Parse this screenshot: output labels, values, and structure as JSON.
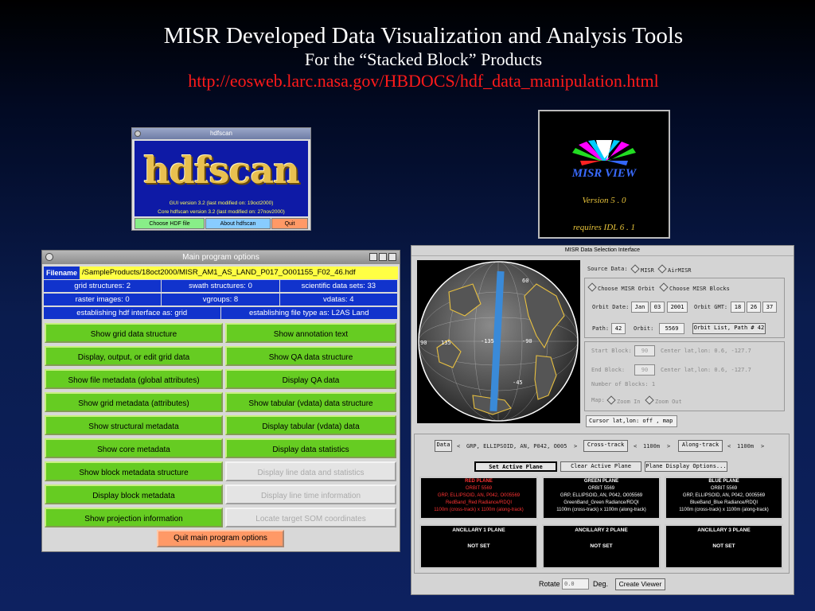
{
  "header": {
    "title": "MISR Developed Data Visualization and Analysis Tools",
    "subtitle": "For the “Stacked Block” Products",
    "url": "http://eosweb.larc.nasa.gov/HBDOCS/hdf_data_manipulation.html"
  },
  "hdfscan": {
    "window_title": "hdfscan",
    "logo": "hdfscan",
    "gui_version": "GUI version 3.2 (last modified on: 19oct2000)",
    "core_version": "Core hdfscan version 3.2 (last modified on: 27nov2000)",
    "buttons": [
      "Choose HDF file",
      "About hdfscan",
      "Quit"
    ]
  },
  "misrview": {
    "title": "MISR VIEW",
    "version": "Version 5 . 0",
    "requires": "requires IDL 6 . 1"
  },
  "main": {
    "window_title": "Main program options",
    "filename_label": "Filename",
    "filename": "/SampleProducts/18oct2000/MISR_AM1_AS_LAND_P017_O001155_F02_46.hdf",
    "stats_row1": [
      "grid structures: 2",
      "swath structures: 0",
      "scientific data sets: 33"
    ],
    "stats_row2": [
      "raster images: 0",
      "vgroups: 8",
      "vdatas: 4"
    ],
    "stats_row3": [
      "establishing hdf interface as: grid",
      "establishing file type as: L2AS Land"
    ],
    "left_buttons": [
      "Show grid data structure",
      "Display, output, or edit grid data",
      "Show file metadata (global attributes)",
      "Show grid metadata (attributes)",
      "Show structural metadata",
      "Show core metadata",
      "Show block metadata structure",
      "Display block metadata",
      "Show projection information"
    ],
    "right_buttons": [
      "Show annotation text",
      "Show QA data structure",
      "Display QA data",
      "Show tabular (vdata) data structure",
      "Display tabular (vdata) data",
      "Display data statistics",
      "Display line data and statistics",
      "Display line time information",
      "Locate target SOM coordinates"
    ],
    "quit": "Quit main program options"
  },
  "dsel": {
    "window_title": "MISR Data Selection Interface",
    "source_label": "Source Data:",
    "source_opts": [
      "MISR",
      "AirMISR"
    ],
    "choose_opts": [
      "Choose MISR Orbit",
      "Choose MISR Blocks"
    ],
    "orbit_date_label": "Orbit Date:",
    "orbit_date": [
      "Jan",
      "03",
      "2001"
    ],
    "orbit_gmt_label": "Orbit GMT:",
    "orbit_gmt": [
      "18",
      "26",
      "37"
    ],
    "path_label": "Path:",
    "path": "42",
    "orbit_label": "Orbit:",
    "orbit": "5569",
    "orbit_list_btn": "Orbit List, Path # 42",
    "start_block_label": "Start Block:",
    "start_block": "90",
    "end_block_label": "End Block:",
    "end_block": "90",
    "center1": "Center lat,lon:  0.6, -127.7",
    "center2": "Center lat,lon:  0.6, -127.7",
    "num_blocks": "Number of Blocks: 1",
    "map_label": "Map:",
    "map_opts": [
      "Zoom In",
      "Zoom Out"
    ],
    "cursor": "Cursor lat,lon:  off , map",
    "data_label": "Data",
    "data_value": "GRP, ELLIPSOID, AN, P042, O005",
    "cross_track": "Cross-track",
    "cross_res": "1100m",
    "along_track": "Along-track",
    "along_res": "1100m",
    "set_active": "Set Active Plane",
    "clear_active": "Clear Active Plane",
    "plane_display": "Plane Display Options...",
    "planes": [
      {
        "title": "RED PLANE",
        "orbit": "ORBIT 5569",
        "grp": "GRP, ELLIPSOID, AN, P042, O005569",
        "band": "RedBand_Red Radiance/RDQI",
        "res": "1100m (cross-track) x 1100m (along-track)"
      },
      {
        "title": "GREEN PLANE",
        "orbit": "ORBIT 5569",
        "grp": "GRP, ELLIPSOID, AN, P042, O005569",
        "band": "GreenBand_Green Radiance/RDQI",
        "res": "1100m (cross-track) x 1100m (along-track)"
      },
      {
        "title": "BLUE PLANE",
        "orbit": "ORBIT 5569",
        "grp": "GRP, ELLIPSOID, AN, P042, O005569",
        "band": "BlueBand_Blue Radiance/RDQI",
        "res": "1100m (cross-track) x 1100m (along-track)"
      }
    ],
    "anc": [
      {
        "title": "ANCILLARY 1 PLANE",
        "status": "NOT SET"
      },
      {
        "title": "ANCILLARY 2 PLANE",
        "status": "NOT SET"
      },
      {
        "title": "ANCILLARY 3 PLANE",
        "status": "NOT SET"
      }
    ],
    "globe_labels": [
      "60",
      "-135",
      "-90",
      "90",
      "135",
      "-45"
    ],
    "rotate_label": "Rotate",
    "rotate_value": "0.0",
    "deg_label": "Deg.",
    "create_viewer": "Create Viewer"
  },
  "colors": {
    "button_green": "#66cc22",
    "header_blue": "#1133cc",
    "filename_yellow": "#ffff44",
    "quit_orange": "#ff9966",
    "url_red": "#ff1a1a"
  }
}
